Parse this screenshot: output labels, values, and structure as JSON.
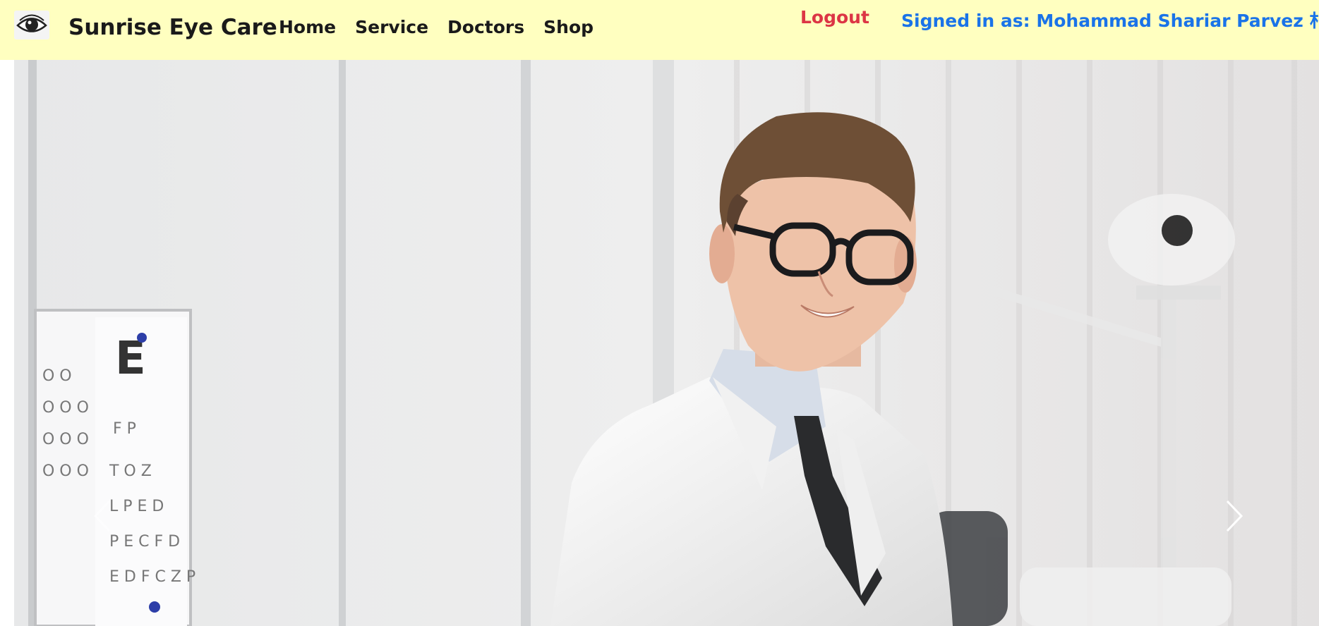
{
  "brand": {
    "name": "Sunrise Eye Care",
    "logo_icon": "eye-icon"
  },
  "nav": {
    "items": [
      {
        "label": "Home"
      },
      {
        "label": "Service"
      },
      {
        "label": "Doctors"
      },
      {
        "label": "Shop"
      }
    ]
  },
  "account": {
    "logout_label": "Logout",
    "signed_in_text": "Signed in as: Mohammad Shariar Parvez 朴维"
  },
  "carousel": {
    "prev_icon": "chevron-left-icon",
    "next_icon": "chevron-right-icon",
    "slide_image": "optometrist-portrait-photo"
  },
  "colors": {
    "navbar_bg": "#ffffc0",
    "logout": "#dc3545",
    "signed_in": "#1a73e8"
  }
}
